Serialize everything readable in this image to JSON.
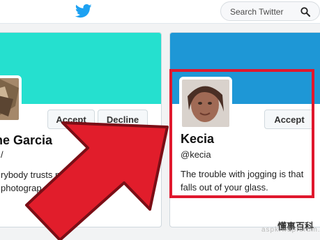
{
  "header": {
    "logo_icon": "twitter-bird-icon",
    "search": {
      "placeholder": "Search Twitter",
      "icon": "search-icon"
    }
  },
  "cards": [
    {
      "name": "ne Garcia",
      "handle": "/",
      "bio": "rybody trusts n               ple\nphotograp",
      "banner_color": "#25e0cf",
      "buttons": {
        "accept": "Accept",
        "decline": "Decline"
      }
    },
    {
      "name": "Kecia",
      "handle": "@kecia",
      "bio": "The trouble with jogging is that\nfalls out of your glass.",
      "banner_color": "#1e97d6",
      "buttons": {
        "accept": "Accept"
      }
    }
  ],
  "highlight_color": "#e0182d",
  "watermark": {
    "text": "懂事百科",
    "url": "aspk.wapforum.com"
  }
}
